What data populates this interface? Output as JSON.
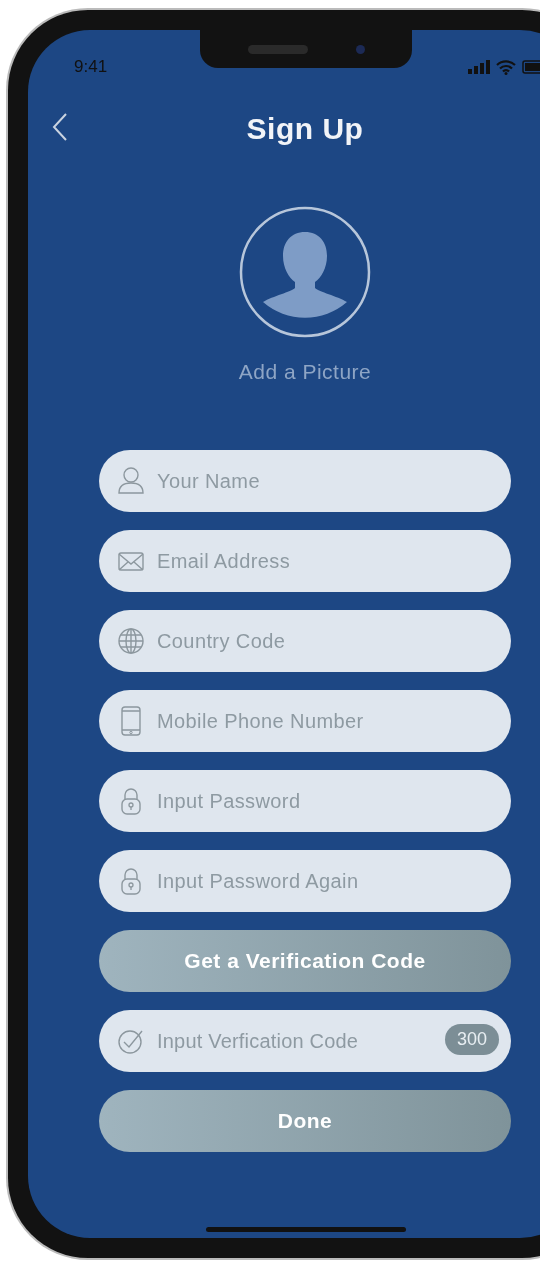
{
  "status_bar": {
    "time": "9:41"
  },
  "header": {
    "title": "Sign Up"
  },
  "avatar": {
    "label": "Add a Picture"
  },
  "fields": [
    {
      "placeholder": "Your Name"
    },
    {
      "placeholder": "Email Address"
    },
    {
      "placeholder": "Country Code"
    },
    {
      "placeholder": "Mobile Phone Number"
    },
    {
      "placeholder": "Input Password"
    },
    {
      "placeholder": "Input Password Again"
    }
  ],
  "verify_button": {
    "label": "Get a Verification Code"
  },
  "code_field": {
    "placeholder": "Input Verfication Code",
    "countdown": "300"
  },
  "done_button": {
    "label": "Done"
  }
}
